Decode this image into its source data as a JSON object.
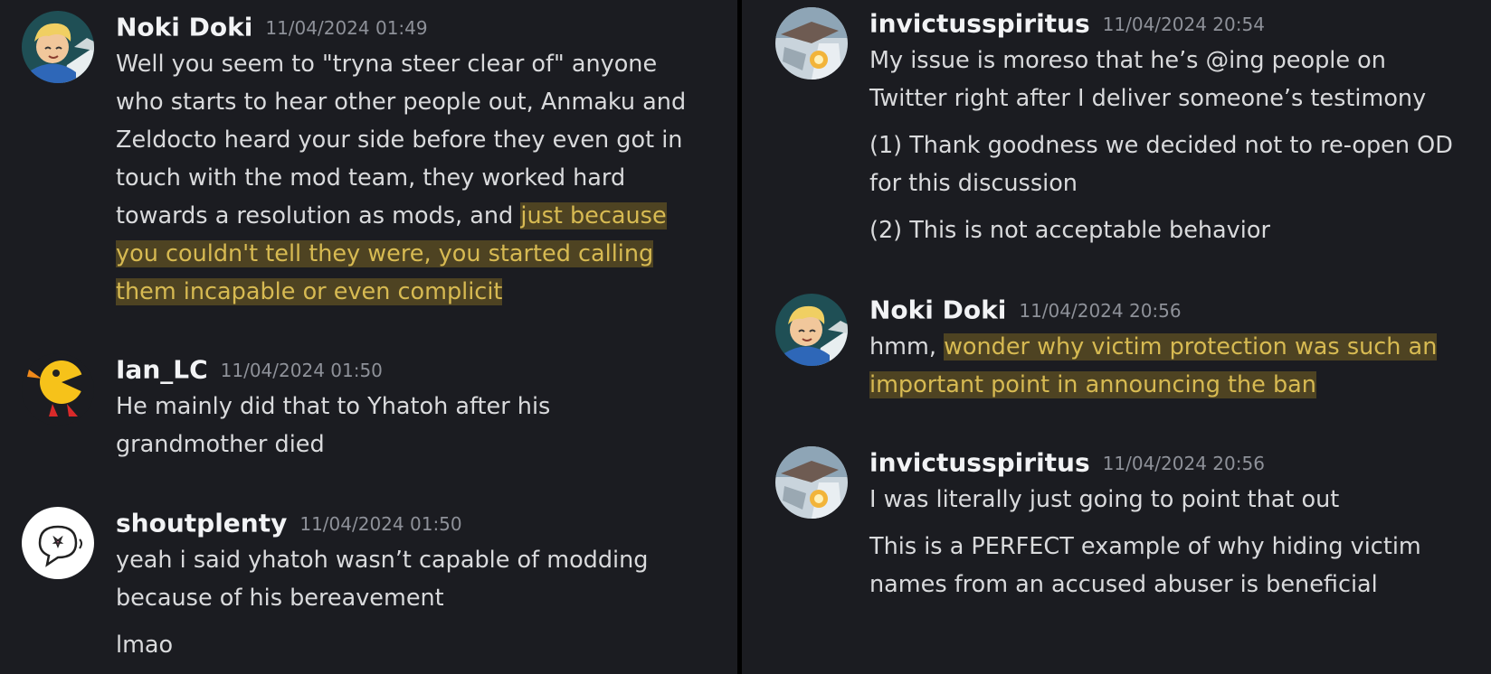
{
  "left": {
    "messages": [
      {
        "author": "Noki Doki",
        "timestamp": "11/04/2024 01:49",
        "avatar": "blonde-character-avatar",
        "lines": [
          "Well you seem to \"tryna steer clear of\" anyone",
          "who starts to hear other people out, Anmaku and",
          "Zeldocto heard your side before they even got in",
          "touch with the mod team, they worked hard",
          "towards a resolution as mods, and "
        ],
        "highlight_lines": [
          "just because",
          "you couldn't tell they were, you started calling",
          "them incapable or even complicit"
        ]
      },
      {
        "author": "Ian_LC",
        "timestamp": "11/04/2024 01:50",
        "avatar": "pacman-character-avatar",
        "lines": [
          "He mainly did that to Yhatoh after his",
          "grandmother died"
        ]
      },
      {
        "author": "shoutplenty",
        "timestamp": "11/04/2024 01:50",
        "avatar": "speech-bubble-avatar",
        "lines": [
          "yeah i said yhatoh wasn’t capable of modding",
          "because of his bereavement"
        ],
        "followup": "lmao"
      }
    ]
  },
  "right": {
    "messages": [
      {
        "author": "invictusspiritus",
        "timestamp": "11/04/2024 20:54",
        "avatar": "ship-illustration-avatar",
        "lines": [
          "My issue is moreso that he’s @ing people on",
          "Twitter right after I deliver someone’s testimony"
        ],
        "para2": [
          "(1) Thank goodness we decided not to re-open OD",
          "for this discussion"
        ],
        "para3": "(2) This is not acceptable behavior"
      },
      {
        "author": "Noki Doki",
        "timestamp": "11/04/2024 20:56",
        "avatar": "blonde-character-avatar",
        "prefix": "hmm, ",
        "highlight_lines": [
          "wonder why victim protection was such an",
          "important point in announcing the ban"
        ]
      },
      {
        "author": "invictusspiritus",
        "timestamp": "11/04/2024 20:56",
        "avatar": "ship-illustration-avatar",
        "lines": [
          "I was literally just going to point that out"
        ],
        "para2": [
          "This is a PERFECT example of why hiding victim",
          "names from an accused abuser is beneficial"
        ]
      }
    ]
  },
  "colors": {
    "background": "#1b1c21",
    "divider": "#000000",
    "author": "#f2f3f5",
    "timestamp": "#8e9199",
    "text": "#d9dadc",
    "highlight_text": "#d7ba52"
  }
}
